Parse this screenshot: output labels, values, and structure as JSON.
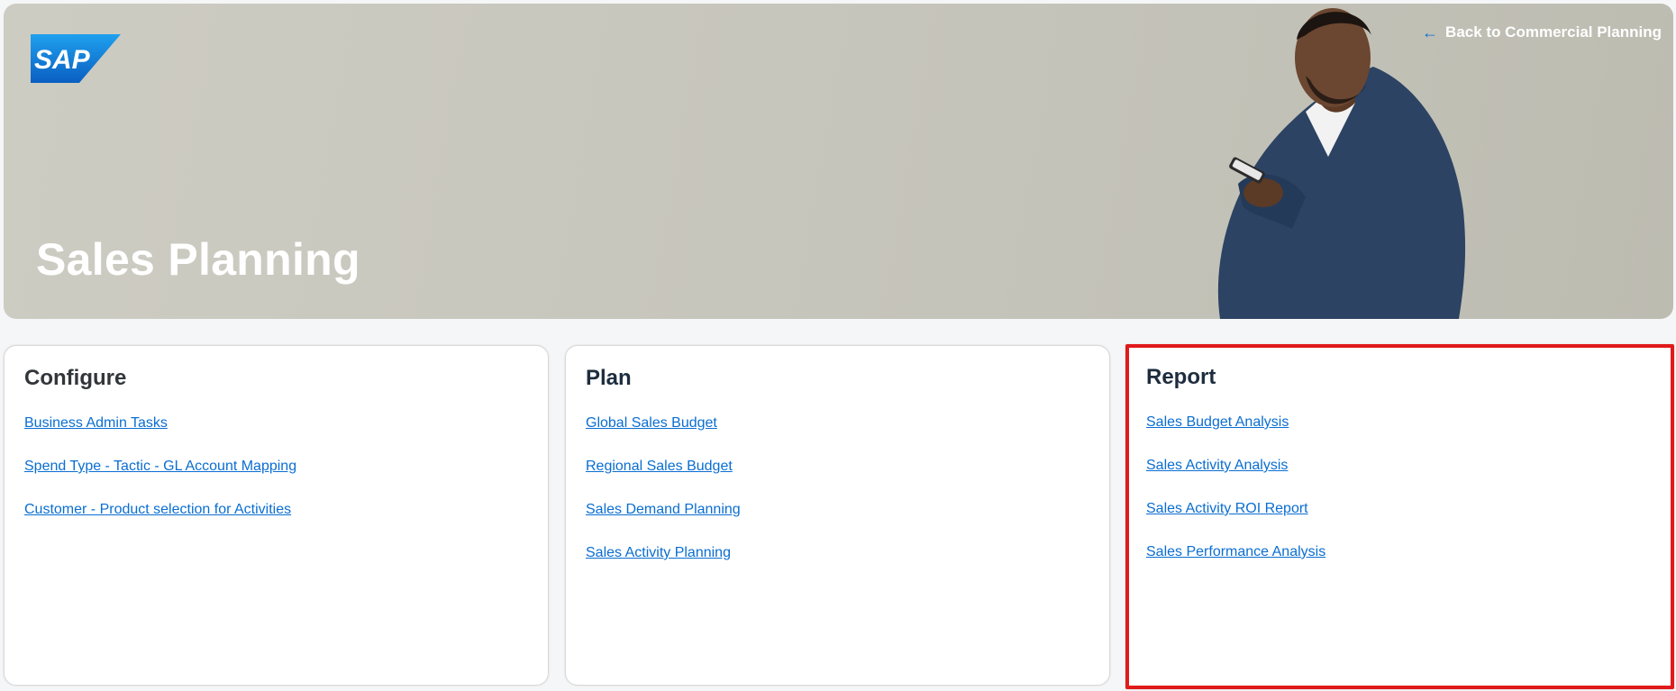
{
  "header": {
    "logo_text": "SAP",
    "back_link_label": "Back to Commercial Planning",
    "title": "Sales Planning"
  },
  "cards": [
    {
      "title": "Configure",
      "links": [
        "Business Admin Tasks",
        "Spend Type - Tactic - GL Account Mapping",
        "Customer - Product selection for Activities"
      ]
    },
    {
      "title": "Plan",
      "links": [
        "Global Sales Budget",
        "Regional Sales Budget",
        "Sales Demand Planning",
        "Sales Activity Planning"
      ]
    },
    {
      "title": "Report",
      "links": [
        "Sales Budget Analysis",
        "Sales Activity Analysis",
        "Sales Activity ROI Report",
        "Sales Performance Analysis"
      ]
    }
  ],
  "colors": {
    "link": "#0a6ed1",
    "highlight_border": "#e11a1a",
    "logo_blue": "#0a6ed1"
  },
  "icons": {
    "back": "arrow-left-icon"
  }
}
